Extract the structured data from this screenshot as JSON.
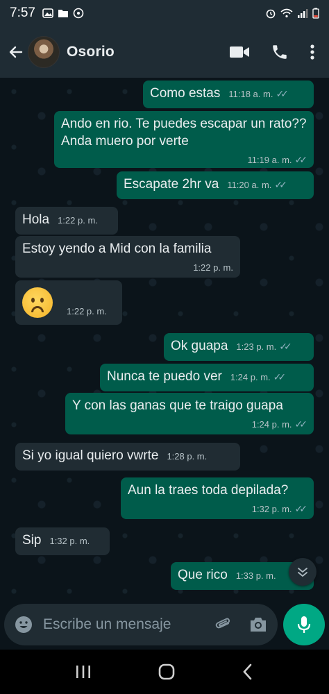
{
  "status_bar": {
    "time": "7:57"
  },
  "header": {
    "contact_name": "Osorio"
  },
  "messages": [
    {
      "dir": "out",
      "text": "Como estas",
      "time": "11:18 a. m."
    },
    {
      "dir": "out",
      "text": "Ando en rio. Te puedes escapar un rato?? Anda muero por verte",
      "time": "11:19 a. m."
    },
    {
      "dir": "out",
      "text": "Escapate 2hr va",
      "time": "11:20 a. m."
    },
    {
      "dir": "in",
      "text": "Hola",
      "time": "1:22 p. m."
    },
    {
      "dir": "in",
      "text": "Estoy yendo a Mid con la familia",
      "time": "1:22 p. m."
    },
    {
      "dir": "in",
      "emoji": "frowning-face",
      "time": "1:22 p. m."
    },
    {
      "dir": "out",
      "text": "Ok guapa",
      "time": "1:23 p. m."
    },
    {
      "dir": "out",
      "text": "Nunca te puedo ver",
      "time": "1:24 p. m."
    },
    {
      "dir": "out",
      "text": "Y con las ganas que te traigo guapa",
      "time": "1:24 p. m."
    },
    {
      "dir": "in",
      "text": "Si yo igual quiero vwrte",
      "time": "1:28 p. m."
    },
    {
      "dir": "out",
      "text": "Aun la traes toda depilada?",
      "time": "1:32 p. m."
    },
    {
      "dir": "in",
      "text": "Sip",
      "time": "1:32 p. m."
    },
    {
      "dir": "out",
      "text": "Que rico",
      "time": "1:33 p. m."
    }
  ],
  "input": {
    "placeholder": "Escribe un mensaje"
  },
  "colors": {
    "outgoing": "#005c4b",
    "incoming": "#202c33",
    "accent": "#00a884",
    "background": "#0b141a"
  },
  "icons": [
    "back-arrow-icon",
    "video-call-icon",
    "phone-icon",
    "more-options-icon",
    "emoji-icon",
    "attach-icon",
    "camera-icon",
    "mic-icon",
    "scroll-down-icon",
    "recents-icon",
    "home-icon",
    "back-nav-icon"
  ]
}
